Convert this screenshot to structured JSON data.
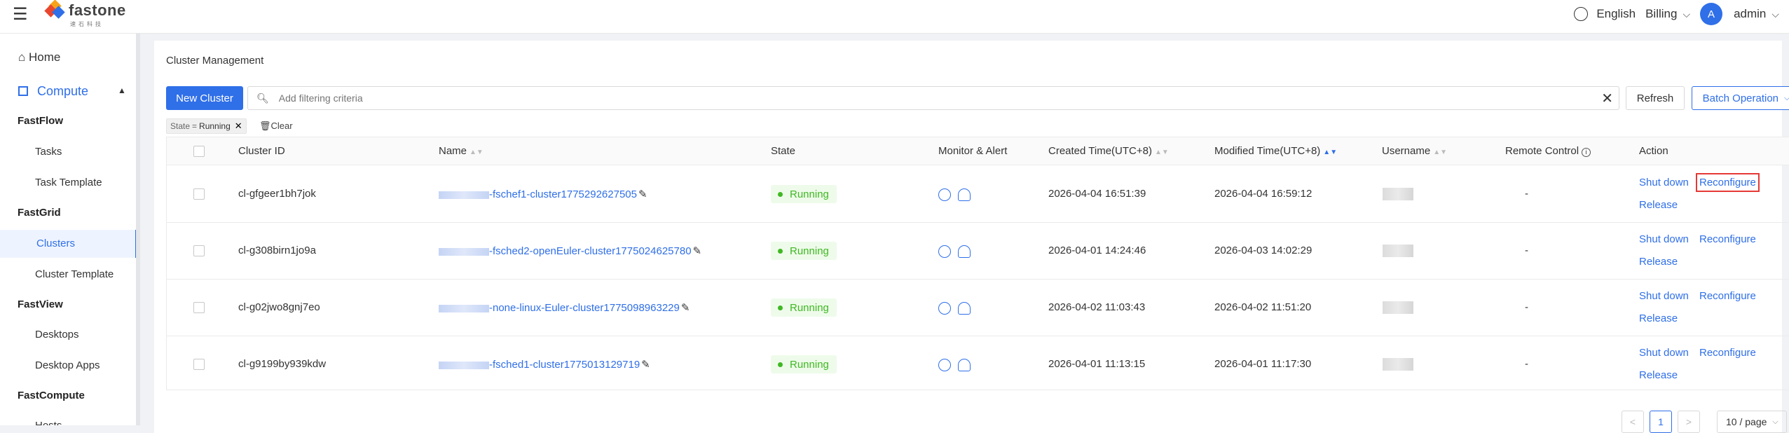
{
  "header": {
    "logo_text": "fastone",
    "logo_sub": "速石科技",
    "language": "English",
    "billing": "Billing",
    "avatar_letter": "A",
    "user": "admin"
  },
  "sidebar": {
    "home": "Home",
    "compute": "Compute",
    "sections": [
      {
        "title": "FastFlow",
        "items": [
          "Tasks",
          "Task Template"
        ]
      },
      {
        "title": "FastGrid",
        "items": [
          "Clusters",
          "Cluster Template"
        ]
      },
      {
        "title": "FastView",
        "items": [
          "Desktops",
          "Desktop Apps"
        ]
      },
      {
        "title": "FastCompute",
        "items": [
          "Hosts"
        ]
      }
    ],
    "active": "Clusters"
  },
  "page": {
    "title": "Cluster Management",
    "new_button": "New Cluster",
    "search_placeholder": "Add filtering criteria",
    "refresh": "Refresh",
    "batch": "Batch Operation",
    "filter_key": "State",
    "filter_op": "=",
    "filter_value": "Running",
    "clear": "Clear"
  },
  "table": {
    "columns": [
      "Cluster ID",
      "Name",
      "State",
      "Monitor & Alert",
      "Created Time(UTC+8)",
      "Modified Time(UTC+8)",
      "Username",
      "Remote Control",
      "Action"
    ],
    "rows": [
      {
        "id": "cl-gfgeer1bh7jok",
        "name": "-fschef1-cluster1775292627505",
        "state": "Running",
        "created": "2026-04-04 16:51:39",
        "modified": "2026-04-04 16:59:12",
        "remote": "-"
      },
      {
        "id": "cl-g308birn1jo9a",
        "name": "-fsched2-openEuler-cluster1775024625780",
        "state": "Running",
        "created": "2026-04-01 14:24:46",
        "modified": "2026-04-03 14:02:29",
        "remote": "-"
      },
      {
        "id": "cl-g02jwo8gnj7eo",
        "name": "-none-linux-Euler-cluster1775098963229",
        "state": "Running",
        "created": "2026-04-02 11:03:43",
        "modified": "2026-04-02 11:51:20",
        "remote": "-"
      },
      {
        "id": "cl-g9199by939kdw",
        "name": "-fsched1-cluster1775013129719",
        "state": "Running",
        "created": "2026-04-01 11:13:15",
        "modified": "2026-04-01 11:17:30",
        "remote": "-"
      }
    ],
    "actions": {
      "shutdown": "Shut down",
      "reconfigure": "Reconfigure",
      "release": "Release"
    }
  },
  "pagination": {
    "page": "1",
    "page_size": "10 / page",
    "prev": "<",
    "next": ">"
  }
}
